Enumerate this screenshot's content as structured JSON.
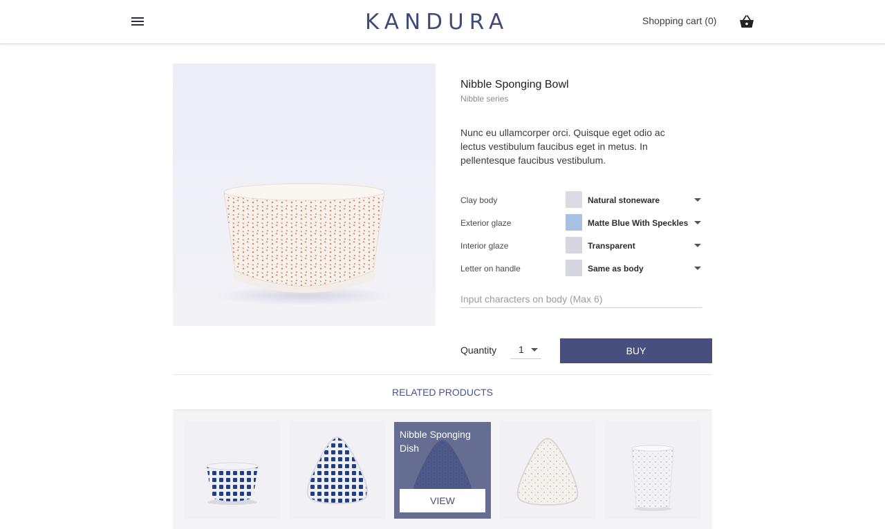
{
  "header": {
    "logo": "KANDURA",
    "cart_label": "Shopping cart",
    "cart_count": "(0)",
    "icons": {
      "menu": "hamburger-menu-icon",
      "cart": "shopping-basket-icon"
    }
  },
  "product": {
    "title": "Nibble Sponging Bowl",
    "series": "Nibble series",
    "description": "Nunc eu ullamcorper orci. Quisque eget odio ac lectus vestibulum faucibus eget in metus. In pellentesque faucibus vestibulum.",
    "options": [
      {
        "label": "Clay body",
        "value": "Natural stoneware",
        "swatch_color": "#d9dae2"
      },
      {
        "label": "Exterior glaze",
        "value": "Matte Blue With Speckles",
        "swatch_color": "#a9c2e2"
      },
      {
        "label": "Interior glaze",
        "value": "Transparent",
        "swatch_color": "#d5d6de"
      },
      {
        "label": "Letter on handle",
        "value": "Same as body",
        "swatch_color": "#d5d6de"
      }
    ],
    "engraving_placeholder": "Input characters on body (Max 6)",
    "quantity_label": "Quantity",
    "quantity_value": "1",
    "buy_label": "BUY"
  },
  "related": {
    "title": "RELATED PRODUCTS",
    "items": [
      {
        "name": ""
      },
      {
        "name": ""
      },
      {
        "name": "Nibble Sponging Dish",
        "view_label": "VIEW"
      },
      {
        "name": ""
      },
      {
        "name": ""
      }
    ]
  },
  "colors": {
    "brand": "#3f4a78",
    "button": "#464f7d",
    "accent_speckle": "#d9825a",
    "blue_pattern": "#1f3f8a"
  }
}
